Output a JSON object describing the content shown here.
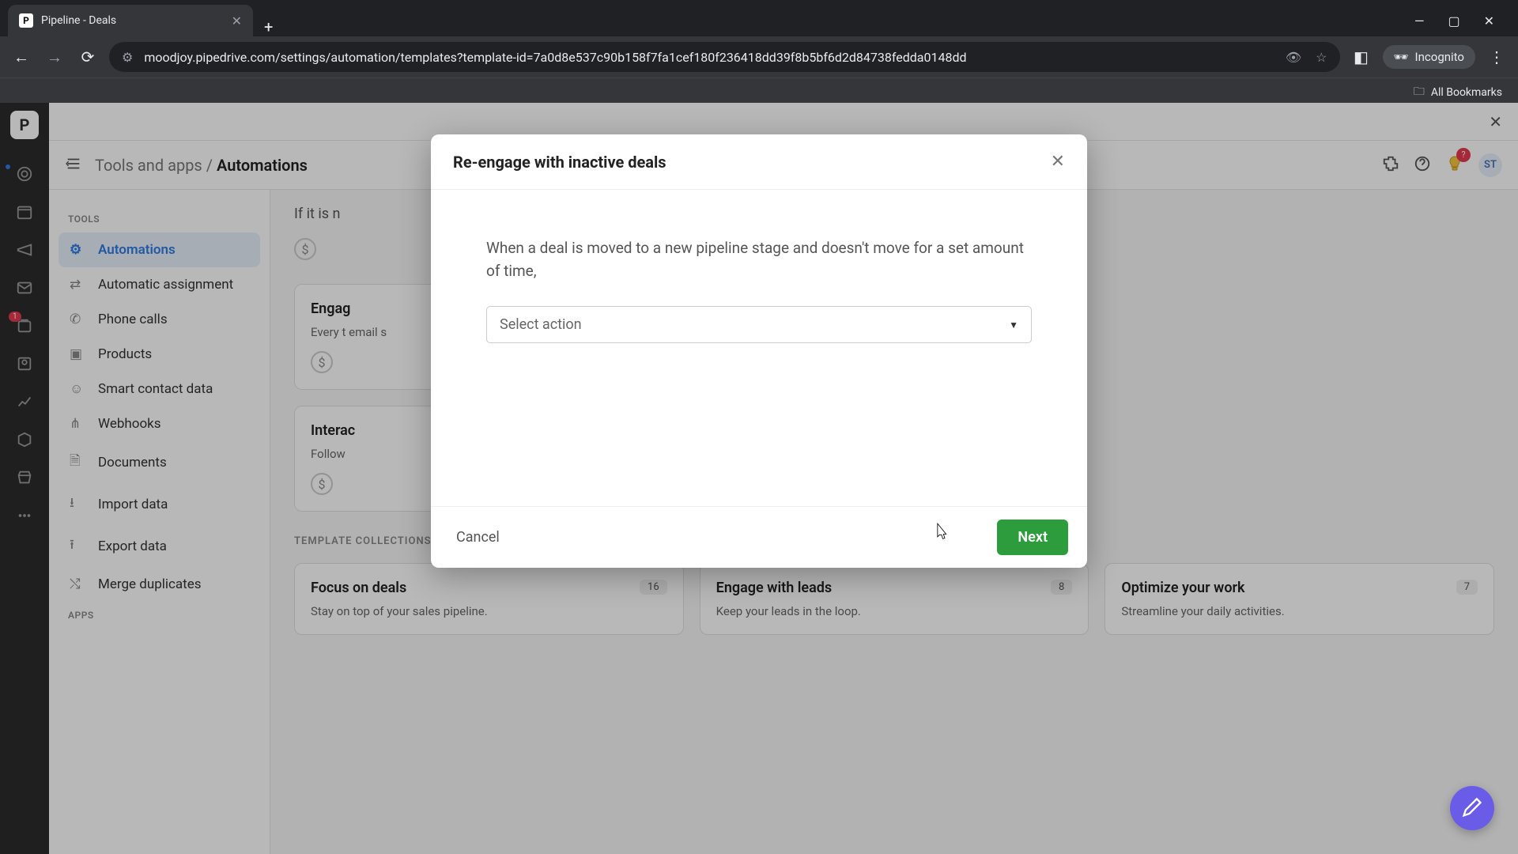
{
  "browser": {
    "tab_title": "Pipeline - Deals",
    "tab_favicon_letter": "P",
    "url": "moodjoy.pipedrive.com/settings/automation/templates?template-id=7a0d8e537c90b158f7fa1cef180f236418dd39f8b5bf6d2d84738fedda0148dd",
    "incognito_label": "Incognito",
    "bookmarks_label": "All Bookmarks"
  },
  "rail": {
    "logo_letter": "P",
    "badge_count": "1"
  },
  "header": {
    "breadcrumb_parent": "Tools and apps",
    "breadcrumb_sep": " / ",
    "breadcrumb_current": "Automations",
    "bulb_badge": "?",
    "avatar_initials": "ST"
  },
  "sidebar": {
    "heading_tools": "TOOLS",
    "heading_apps": "APPS",
    "items": [
      {
        "label": "Automations"
      },
      {
        "label": "Automatic assignment"
      },
      {
        "label": "Phone calls"
      },
      {
        "label": "Products"
      },
      {
        "label": "Smart contact data"
      },
      {
        "label": "Webhooks"
      },
      {
        "label": "Documents"
      },
      {
        "label": "Import data"
      },
      {
        "label": "Export data"
      },
      {
        "label": "Merge duplicates"
      }
    ]
  },
  "content": {
    "partial_line": "If it is n",
    "card_engage_title": "Engag",
    "card_engage_desc": "Every t\nemail s",
    "card_interact_title": "Interac",
    "card_interact_desc": "Follow",
    "section_heading": "TEMPLATE COLLECTIONS",
    "collections": [
      {
        "title": "Focus on deals",
        "badge": "16",
        "sub": "Stay on top of your sales pipeline."
      },
      {
        "title": "Engage with leads",
        "badge": "8",
        "sub": "Keep your leads in the loop."
      },
      {
        "title": "Optimize your work",
        "badge": "7",
        "sub": "Streamline your daily activities."
      }
    ]
  },
  "modal": {
    "title": "Re-engage with inactive deals",
    "description": "When a deal is moved to a new pipeline stage and doesn't move for a set amount of time,",
    "select_placeholder": "Select action",
    "cancel_label": "Cancel",
    "next_label": "Next"
  }
}
